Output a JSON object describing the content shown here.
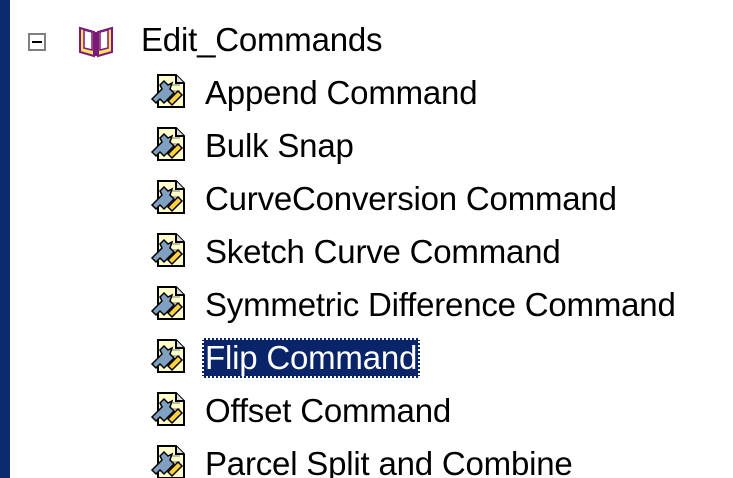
{
  "tree": {
    "root": {
      "label": "Edit_Commands",
      "expanded": true,
      "icon": "book-icon"
    },
    "children": [
      {
        "label": "Append Command",
        "icon": "tool-script-icon",
        "selected": false
      },
      {
        "label": "Bulk Snap",
        "icon": "tool-script-icon",
        "selected": false
      },
      {
        "label": "CurveConversion Command",
        "icon": "tool-script-icon",
        "selected": false
      },
      {
        "label": "Sketch Curve Command",
        "icon": "tool-script-icon",
        "selected": false
      },
      {
        "label": "Symmetric Difference Command",
        "icon": "tool-script-icon",
        "selected": false
      },
      {
        "label": "Flip Command",
        "icon": "tool-script-icon",
        "selected": true
      },
      {
        "label": "Offset Command",
        "icon": "tool-script-icon",
        "selected": false
      },
      {
        "label": "Parcel Split and Combine",
        "icon": "tool-script-icon",
        "selected": false
      }
    ]
  },
  "colors": {
    "frame": "#0b2a6f",
    "background": "#ffffff",
    "selection": "#0a246a",
    "selection_text": "#ffffff"
  }
}
